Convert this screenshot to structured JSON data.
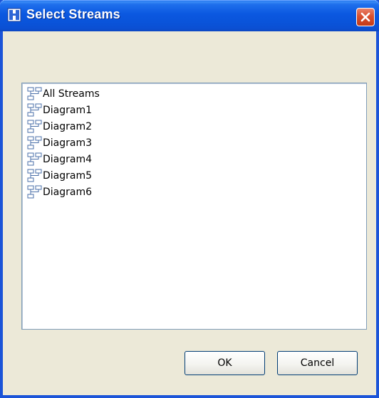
{
  "window": {
    "title": "Select Streams",
    "close_icon": "close-icon",
    "title_icon": "window-icon"
  },
  "stream_list": {
    "item_icon": "tree-hierarchy-icon",
    "items": [
      {
        "label": "All Streams"
      },
      {
        "label": "Diagram1"
      },
      {
        "label": "Diagram2"
      },
      {
        "label": "Diagram3"
      },
      {
        "label": "Diagram4"
      },
      {
        "label": "Diagram5"
      },
      {
        "label": "Diagram6"
      }
    ]
  },
  "buttons": {
    "ok_label": "OK",
    "cancel_label": "Cancel"
  },
  "colors": {
    "titlebar": "#0b58e0",
    "window_bg": "#ece9d8",
    "close_button": "#d9502f",
    "list_border": "#7f9db9"
  }
}
